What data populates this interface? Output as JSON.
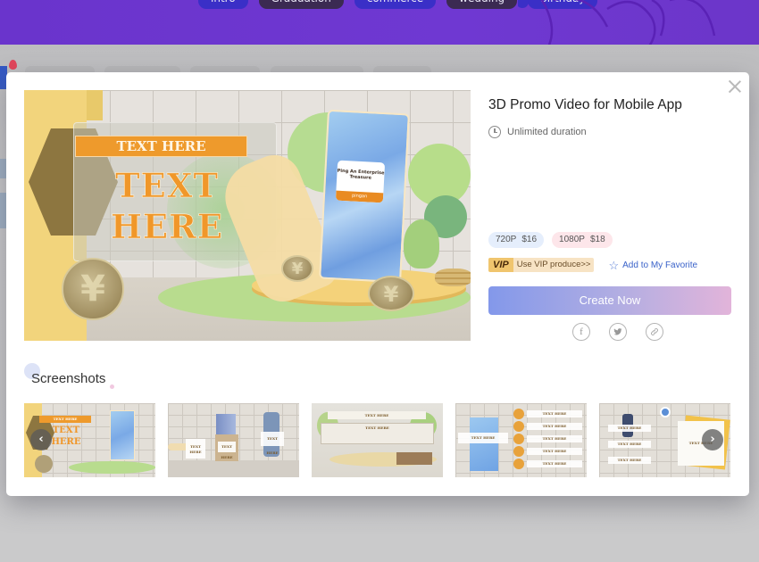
{
  "background": {
    "hero_tags": [
      {
        "label": "intro",
        "style": "blue"
      },
      {
        "label": "Graduation",
        "style": "dark"
      },
      {
        "label": "commerce",
        "style": "blue"
      },
      {
        "label": "wedding",
        "style": "dark"
      },
      {
        "label": "birthday",
        "style": "blue"
      }
    ],
    "colors": {
      "hero": "#6a34cc",
      "overlay": "#c9c9cb"
    }
  },
  "modal": {
    "close_icon": "close-icon",
    "preview": {
      "banner_text": "TEXT HERE",
      "big_text_line1": "TEXT",
      "big_text_line2": "HERE",
      "app_card_title": "Ping An Enterprise Treasure",
      "app_card_brand": "pingan"
    },
    "title": "3D Promo Video for Mobile App",
    "duration": {
      "icon": "clock-icon",
      "label": "Unlimited duration"
    },
    "prices": [
      {
        "resolution": "720P",
        "price": "$16",
        "color": "#e5eefc"
      },
      {
        "resolution": "1080P",
        "price": "$18",
        "color": "#fde6ea"
      }
    ],
    "vip": {
      "badge": "VIP",
      "label": "Use VIP produce>>"
    },
    "favorite": {
      "icon": "star-icon",
      "label": "Add to My Favorite"
    },
    "create_button": "Create Now",
    "share": [
      {
        "icon": "facebook-icon",
        "glyph": "f"
      },
      {
        "icon": "twitter-icon",
        "glyph": "🐦"
      },
      {
        "icon": "link-icon",
        "glyph": "🔗"
      }
    ],
    "screenshots": {
      "title": "Screenshots",
      "items": [
        {
          "name": "screenshot-1",
          "labels": [
            "TEXT HERE",
            "TEXT",
            "HERE"
          ]
        },
        {
          "name": "screenshot-2",
          "labels": [
            "TEXT HERE",
            "TEXT HERE",
            "TEXT HERE"
          ]
        },
        {
          "name": "screenshot-3",
          "labels": [
            "TEXT HERE",
            "TEXT HERE"
          ]
        },
        {
          "name": "screenshot-4",
          "labels": [
            "TEXT HERE",
            "TEXT HERE",
            "TEXT HERE",
            "TEXT HERE",
            "TEXT HERE",
            "TEXT HERE"
          ]
        },
        {
          "name": "screenshot-5",
          "labels": [
            "TEXT HERE",
            "TEXT HERE",
            "TEXT HERE",
            "TEXT HERE"
          ]
        }
      ],
      "prev_icon": "‹",
      "next_icon": "›"
    }
  }
}
